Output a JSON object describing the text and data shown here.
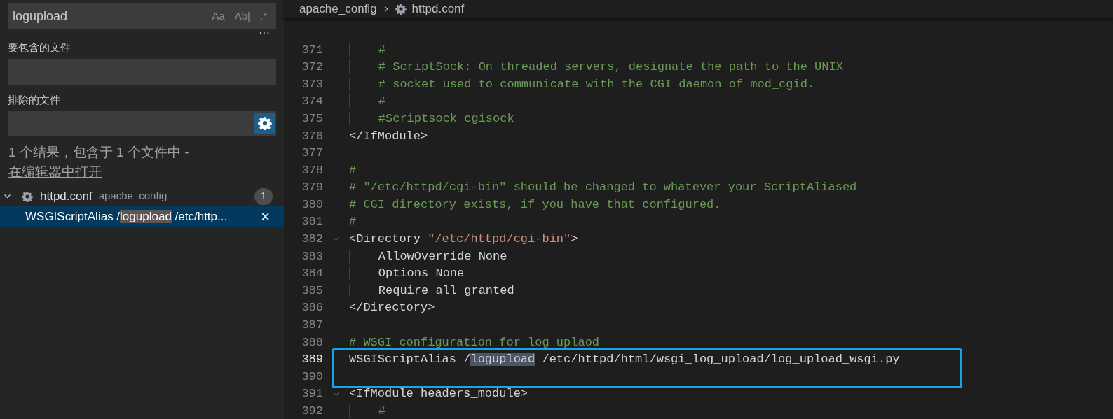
{
  "search": {
    "value": "logupload",
    "options": [
      {
        "label": "Aa",
        "selected": false
      },
      {
        "label": "Ab|",
        "selected": false
      },
      {
        "label": ".*",
        "selected": false
      }
    ],
    "more": "···"
  },
  "include": {
    "label": "要包含的文件"
  },
  "exclude": {
    "label": "排除的文件",
    "ignore_settings": true
  },
  "summary": {
    "text": "1 个结果，包含于 1 个文件中 - ",
    "link": "在编辑器中打开"
  },
  "results": [
    {
      "file": "httpd.conf",
      "folder": "apache_config",
      "count": "1",
      "expanded": true,
      "matches": [
        {
          "before": "WSGIScriptAlias /",
          "match": "logupload",
          "after": " /etc/http...",
          "selected": true,
          "close": "×"
        }
      ]
    }
  ],
  "breadcrumb": {
    "folder": "apache_config",
    "file": "httpd.conf"
  },
  "lines": [
    {
      "number": "371",
      "segments": [
        {
          "kind": "comment",
          "text": "    #"
        }
      ]
    },
    {
      "number": "372",
      "segments": [
        {
          "kind": "comment",
          "text": "    # ScriptSock: On threaded servers, designate the path to the UNIX"
        }
      ]
    },
    {
      "number": "373",
      "segments": [
        {
          "kind": "comment",
          "text": "    # socket used to communicate with the CGI daemon of mod_cgid."
        }
      ]
    },
    {
      "number": "374",
      "segments": [
        {
          "kind": "comment",
          "text": "    #"
        }
      ]
    },
    {
      "number": "375",
      "segments": [
        {
          "kind": "comment",
          "text": "    #Scriptsock cgisock"
        }
      ]
    },
    {
      "number": "376",
      "segments": [
        {
          "kind": "plain",
          "text": "</IfModule>"
        }
      ]
    },
    {
      "number": "377"
    },
    {
      "number": "378",
      "segments": [
        {
          "kind": "comment",
          "text": "#"
        }
      ]
    },
    {
      "number": "379",
      "segments": [
        {
          "kind": "comment",
          "text": "# \"/etc/httpd/cgi-bin\" should be changed to whatever your ScriptAliased"
        }
      ]
    },
    {
      "number": "380",
      "segments": [
        {
          "kind": "comment",
          "text": "# CGI directory exists, if you have that configured."
        }
      ]
    },
    {
      "number": "381",
      "segments": [
        {
          "kind": "comment",
          "text": "#"
        }
      ]
    },
    {
      "number": "382",
      "foldable": true,
      "segments": [
        {
          "kind": "plain",
          "text": "<Directory "
        },
        {
          "kind": "string",
          "text": "\"/etc/httpd/cgi-bin\""
        },
        {
          "kind": "plain",
          "text": ">"
        }
      ]
    },
    {
      "number": "383",
      "segments": [
        {
          "kind": "plain",
          "text": "    AllowOverride None"
        }
      ]
    },
    {
      "number": "384",
      "segments": [
        {
          "kind": "plain",
          "text": "    Options None"
        }
      ]
    },
    {
      "number": "385",
      "segments": [
        {
          "kind": "plain",
          "text": "    Require all granted"
        }
      ]
    },
    {
      "number": "386",
      "segments": [
        {
          "kind": "plain",
          "text": "</Directory>"
        }
      ]
    },
    {
      "number": "387"
    },
    {
      "number": "388",
      "segments": [
        {
          "kind": "comment",
          "text": "# WSGI configuration for log uplaod"
        }
      ]
    },
    {
      "number": "389",
      "active": true,
      "boxed": true,
      "segments": [
        {
          "kind": "plain",
          "text": "WSGIScriptAlias /"
        },
        {
          "kind": "match",
          "text": "logupload"
        },
        {
          "kind": "plain",
          "text": " /etc/httpd/html/wsgi_log_upload/log_upload_wsgi.py"
        }
      ]
    },
    {
      "number": "390",
      "boxed": true
    },
    {
      "number": "391",
      "foldable": true,
      "segments": [
        {
          "kind": "plain",
          "text": "<IfModule headers_module>"
        }
      ]
    },
    {
      "number": "392",
      "segments": [
        {
          "kind": "comment",
          "text": "    #"
        }
      ]
    }
  ]
}
